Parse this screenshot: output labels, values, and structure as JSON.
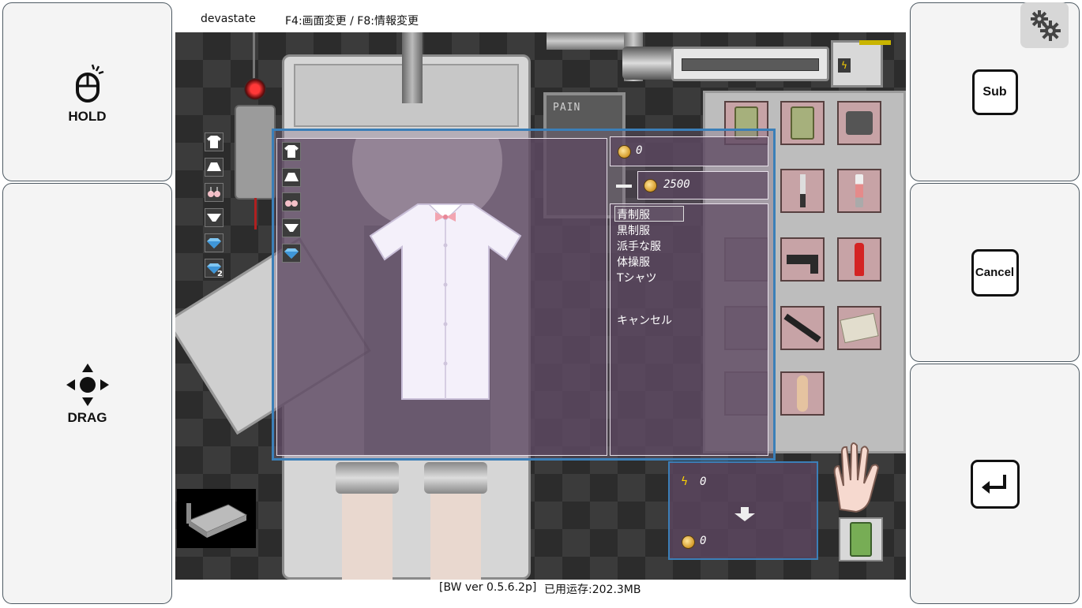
{
  "header": {
    "mode_label": "devastate",
    "hint_label": "F4:画面変更 / F8:情報変更"
  },
  "footer": {
    "version_label": "[BW ver 0.5.6.2p]",
    "memory_label": "已用运存:202.3MB"
  },
  "left_controls": {
    "hold_label": "HOLD",
    "drag_label": "DRAG"
  },
  "right_controls": {
    "sub_label": "Sub",
    "cancel_label": "Cancel"
  },
  "purchase": {
    "owned_amount": "0",
    "price_amount": "2500",
    "options": [
      "青制服",
      "黒制服",
      "派手な服",
      "体操服",
      "Tシャツ"
    ],
    "cancel_label": "キャンセル",
    "selected_index": 0
  },
  "status_box": {
    "energy_amount": "0",
    "coin_amount": "0"
  },
  "machine": {
    "monitor_label": "PAIN"
  },
  "side_slots": {
    "badge_number": "2"
  },
  "colors": {
    "panel_bg": "#5c4660",
    "item_slot": "#c7a3a6",
    "highlight_border": "#3b7fb8"
  }
}
